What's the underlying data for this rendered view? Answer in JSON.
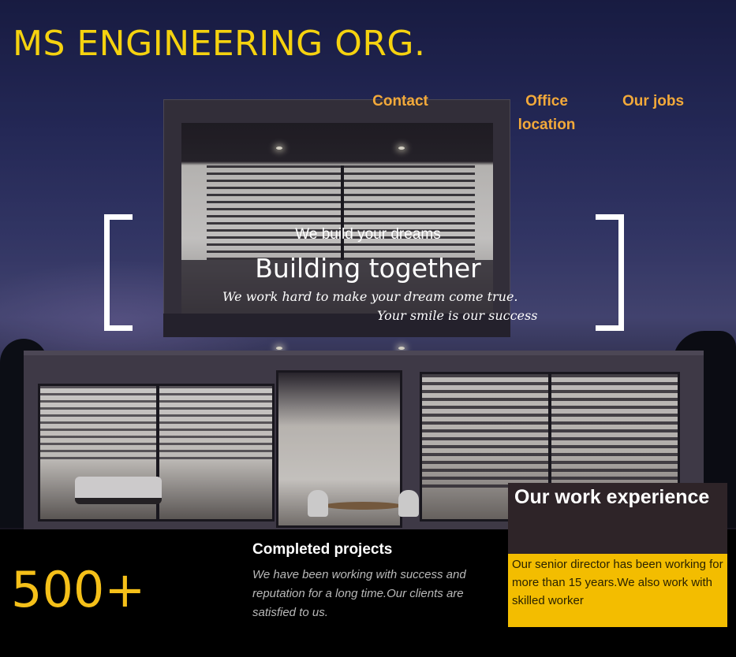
{
  "brand": {
    "title": "MS ENGINEERING ORG.",
    "title_color": "#f5d20f"
  },
  "nav": {
    "link_color": "#f2a93a",
    "items": [
      {
        "label": "Contact"
      },
      {
        "label": "Office location"
      },
      {
        "label": "Our jobs"
      }
    ]
  },
  "hero": {
    "kicker": "We build your dreams",
    "headline": "Building together",
    "line1": "We work hard to make your dream come true.",
    "line2": "Your smile is our success",
    "image_icon": "house-photo"
  },
  "stats": {
    "number": "500+",
    "number_color": "#f5c019",
    "title": "Completed projects",
    "description": "We have been working with success and reputation for a long time.Our clients are satisfied to us."
  },
  "experience": {
    "title": "Our work experience",
    "text": "Our senior director has been working for more than 15 years.We also work with skilled worker",
    "accent": "#f3bd00",
    "header_bg": "#2e2428"
  }
}
